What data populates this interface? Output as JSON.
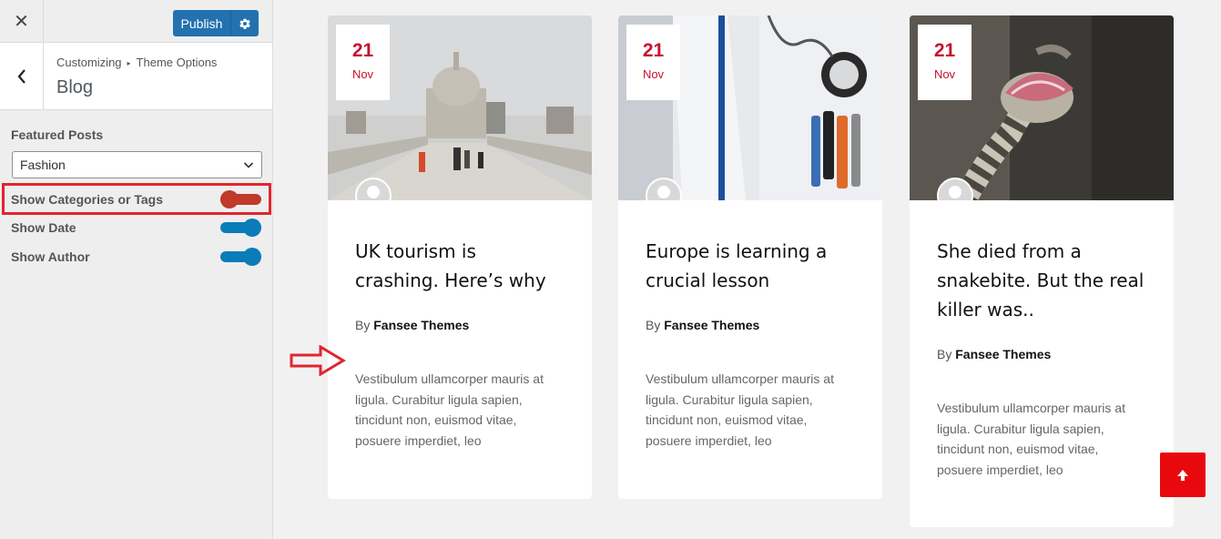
{
  "customizer": {
    "close_symbol": "✕",
    "publish_label": "Publish",
    "breadcrumb": [
      "Customizing",
      "Theme Options"
    ],
    "section_title": "Blog",
    "featured_posts_label": "Featured Posts",
    "featured_posts_value": "Fashion",
    "toggles": [
      {
        "label": "Show Categories or Tags",
        "on": false,
        "color": "#c0392b"
      },
      {
        "label": "Show Date",
        "on": true,
        "color": "#0a7cb8"
      },
      {
        "label": "Show Author",
        "on": true,
        "color": "#0a7cb8"
      }
    ]
  },
  "posts": [
    {
      "day": "21",
      "month": "Nov",
      "title_lines": [
        "UK tourism is",
        "crashing. Here’s why"
      ],
      "by": "By",
      "author": "Fansee Themes",
      "excerpt": "Vestibulum ullamcorper mauris at ligula. Curabitur ligula sapien, tincidunt non, euismod vitae, posuere imperdiet, leo"
    },
    {
      "day": "21",
      "month": "Nov",
      "title_lines": [
        "Europe is learning a",
        "crucial lesson"
      ],
      "by": "By",
      "author": "Fansee Themes",
      "excerpt": "Vestibulum ullamcorper mauris at ligula. Curabitur ligula sapien, tincidunt non, euismod vitae, posuere imperdiet, leo"
    },
    {
      "day": "21",
      "month": "Nov",
      "title_lines": [
        "She died from a",
        "snakebite. But the real",
        "killer was.."
      ],
      "by": "By",
      "author": "Fansee Themes",
      "excerpt": "Vestibulum ullamcorper mauris at ligula. Curabitur ligula sapien, tincidunt non, euismod vitae, posuere imperdiet, leo"
    }
  ],
  "colors": {
    "accent_red": "#c8102e",
    "primary_blue": "#2271b1",
    "to_top": "#e8090f"
  },
  "icons": [
    "close-icon",
    "gear-icon",
    "back-chevron-icon",
    "chevron-down-icon",
    "avatar-icon",
    "arrow-right-icon",
    "arrow-up-icon"
  ]
}
